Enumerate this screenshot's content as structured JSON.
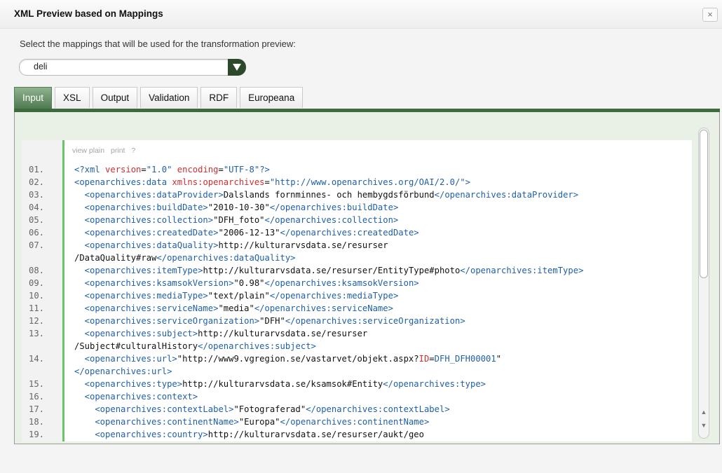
{
  "dialog": {
    "title": "XML Preview based on Mappings",
    "close_label": "×",
    "instruction": "Select the mappings that will be used for the transformation preview:"
  },
  "mapping_select": {
    "value": "deli"
  },
  "tabs": [
    {
      "label": "Input",
      "active": true
    },
    {
      "label": "XSL",
      "active": false
    },
    {
      "label": "Output",
      "active": false
    },
    {
      "label": "Validation",
      "active": false
    },
    {
      "label": "RDF",
      "active": false
    },
    {
      "label": "Europeana",
      "active": false
    }
  ],
  "code_toolbar": {
    "view_plain": "view plain",
    "print": "print",
    "help": "?"
  },
  "colors": {
    "tag": "#1f5fa8",
    "attribute": "#d22d2d",
    "accent_green": "#3d6b3e",
    "gutter_border": "#6cc36a"
  },
  "code_lines": [
    {
      "num": "01.",
      "segments": [
        {
          "text": "<?xml ",
          "cls": "tag"
        },
        {
          "text": "version",
          "cls": "attr"
        },
        {
          "text": "=",
          "cls": ""
        },
        {
          "text": "\"1.0\"",
          "cls": "val"
        },
        {
          "text": " ",
          "cls": ""
        },
        {
          "text": "encoding",
          "cls": "attr"
        },
        {
          "text": "=",
          "cls": ""
        },
        {
          "text": "\"UTF-8\"",
          "cls": "val"
        },
        {
          "text": "?>",
          "cls": "tag"
        }
      ]
    },
    {
      "num": "02.",
      "segments": [
        {
          "text": "<openarchives:data ",
          "cls": "tag"
        },
        {
          "text": "xmlns:openarchives",
          "cls": "attr"
        },
        {
          "text": "=",
          "cls": ""
        },
        {
          "text": "\"http://www.openarchives.org/OAI/2.0/\"",
          "cls": "val"
        },
        {
          "text": ">",
          "cls": "tag"
        }
      ]
    },
    {
      "num": "03.",
      "segments": [
        {
          "text": "  <openarchives:dataProvider>",
          "cls": "tag"
        },
        {
          "text": "Dalslands fornminnes- och hembygdsförbund",
          "cls": ""
        },
        {
          "text": "</openarchives:dataProvider>",
          "cls": "tag"
        }
      ]
    },
    {
      "num": "04.",
      "segments": [
        {
          "text": "  <openarchives:buildDate>",
          "cls": "tag"
        },
        {
          "text": "\"2010-10-30\"",
          "cls": ""
        },
        {
          "text": "</openarchives:buildDate>",
          "cls": "tag"
        }
      ]
    },
    {
      "num": "05.",
      "segments": [
        {
          "text": "  <openarchives:collection>",
          "cls": "tag"
        },
        {
          "text": "\"DFH_foto\"",
          "cls": ""
        },
        {
          "text": "</openarchives:collection>",
          "cls": "tag"
        }
      ]
    },
    {
      "num": "06.",
      "segments": [
        {
          "text": "  <openarchives:createdDate>",
          "cls": "tag"
        },
        {
          "text": "\"2006-12-13\"",
          "cls": ""
        },
        {
          "text": "</openarchives:createdDate>",
          "cls": "tag"
        }
      ]
    },
    {
      "num": "07.",
      "segments": [
        {
          "text": "  <openarchives:dataQuality>",
          "cls": "tag"
        },
        {
          "text": "http://kulturarvsdata.se/resurser",
          "cls": ""
        }
      ],
      "wrap": [
        {
          "text": "/DataQuality#raw",
          "cls": ""
        },
        {
          "text": "</openarchives:dataQuality>",
          "cls": "tag"
        }
      ]
    },
    {
      "num": "08.",
      "segments": [
        {
          "text": "  <openarchives:itemType>",
          "cls": "tag"
        },
        {
          "text": "http://kulturarvsdata.se/resurser/EntityType#photo",
          "cls": ""
        },
        {
          "text": "</openarchives:itemType>",
          "cls": "tag"
        }
      ]
    },
    {
      "num": "09.",
      "segments": [
        {
          "text": "  <openarchives:ksamsokVersion>",
          "cls": "tag"
        },
        {
          "text": "\"0.98\"",
          "cls": ""
        },
        {
          "text": "</openarchives:ksamsokVersion>",
          "cls": "tag"
        }
      ]
    },
    {
      "num": "10.",
      "segments": [
        {
          "text": "  <openarchives:mediaType>",
          "cls": "tag"
        },
        {
          "text": "\"text/plain\"",
          "cls": ""
        },
        {
          "text": "</openarchives:mediaType>",
          "cls": "tag"
        }
      ]
    },
    {
      "num": "11.",
      "segments": [
        {
          "text": "  <openarchives:serviceName>",
          "cls": "tag"
        },
        {
          "text": "\"media\"",
          "cls": ""
        },
        {
          "text": "</openarchives:serviceName>",
          "cls": "tag"
        }
      ]
    },
    {
      "num": "12.",
      "segments": [
        {
          "text": "  <openarchives:serviceOrganization>",
          "cls": "tag"
        },
        {
          "text": "\"DFH\"",
          "cls": ""
        },
        {
          "text": "</openarchives:serviceOrganization>",
          "cls": "tag"
        }
      ]
    },
    {
      "num": "13.",
      "segments": [
        {
          "text": "  <openarchives:subject>",
          "cls": "tag"
        },
        {
          "text": "http://kulturarvsdata.se/resurser",
          "cls": ""
        }
      ],
      "wrap": [
        {
          "text": "/Subject#culturalHistory",
          "cls": ""
        },
        {
          "text": "</openarchives:subject>",
          "cls": "tag"
        }
      ]
    },
    {
      "num": "14.",
      "segments": [
        {
          "text": "  <openarchives:url>",
          "cls": "tag"
        },
        {
          "text": "\"http://www9.vgregion.se/vastarvet/objekt.aspx?",
          "cls": ""
        },
        {
          "text": "ID",
          "cls": "attr"
        },
        {
          "text": "=",
          "cls": ""
        },
        {
          "text": "DFH_DFH00001",
          "cls": "val"
        },
        {
          "text": "\"",
          "cls": ""
        }
      ],
      "wrap": [
        {
          "text": "</openarchives:url>",
          "cls": "tag"
        }
      ]
    },
    {
      "num": "15.",
      "segments": [
        {
          "text": "  <openarchives:type>",
          "cls": "tag"
        },
        {
          "text": "http://kulturarvsdata.se/ksamsok#Entity",
          "cls": ""
        },
        {
          "text": "</openarchives:type>",
          "cls": "tag"
        }
      ]
    },
    {
      "num": "16.",
      "segments": [
        {
          "text": "  <openarchives:context>",
          "cls": "tag"
        }
      ]
    },
    {
      "num": "17.",
      "segments": [
        {
          "text": "    <openarchives:contextLabel>",
          "cls": "tag"
        },
        {
          "text": "\"Fotograferad\"",
          "cls": ""
        },
        {
          "text": "</openarchives:contextLabel>",
          "cls": "tag"
        }
      ]
    },
    {
      "num": "18.",
      "segments": [
        {
          "text": "    <openarchives:continentName>",
          "cls": "tag"
        },
        {
          "text": "\"Europa\"",
          "cls": ""
        },
        {
          "text": "</openarchives:continentName>",
          "cls": "tag"
        }
      ]
    },
    {
      "num": "19.",
      "segments": [
        {
          "text": "    <openarchives:country>",
          "cls": "tag"
        },
        {
          "text": "http://kulturarvsdata.se/resurser/aukt/geo",
          "cls": ""
        }
      ]
    }
  ]
}
